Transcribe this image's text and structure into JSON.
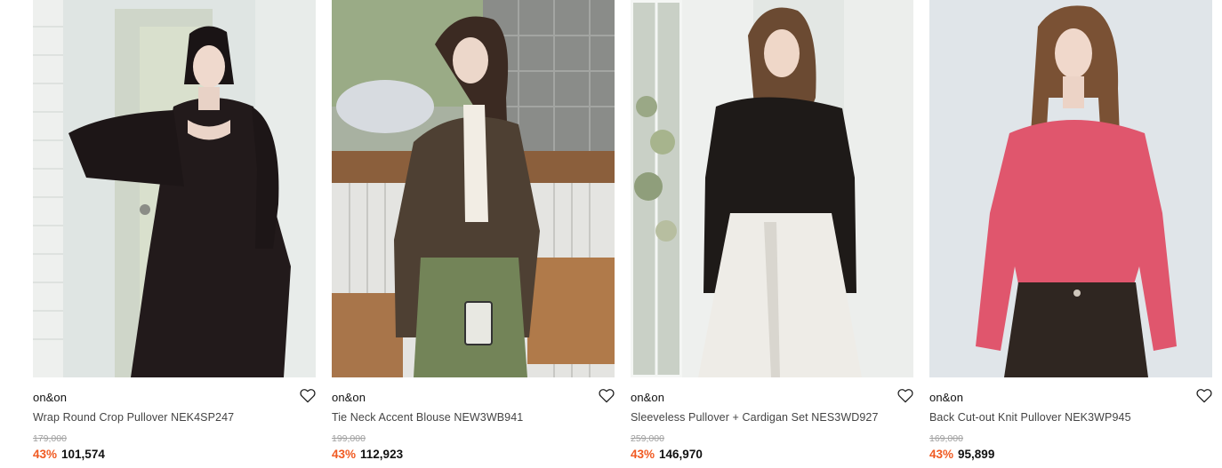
{
  "products": [
    {
      "brand": "on&on",
      "name": "Wrap Round Crop Pullover NEK4SP247",
      "original_price": "179,000",
      "discount": "43%",
      "sale_price": "101,574",
      "wishlist_icon": "heart-outline-icon",
      "colors": {
        "bg": "#dde3e1",
        "garment": "#211819"
      }
    },
    {
      "brand": "on&on",
      "name": "Tie Neck Accent Blouse NEW3WB941",
      "original_price": "199,000",
      "discount": "43%",
      "sale_price": "112,923",
      "wishlist_icon": "heart-outline-icon",
      "colors": {
        "bg": "#b9b6ab",
        "garment": "#4e4134"
      }
    },
    {
      "brand": "on&on",
      "name": "Sleeveless Pullover + Cardigan Set NES3WD927",
      "original_price": "259,000",
      "discount": "43%",
      "sale_price": "146,970",
      "wishlist_icon": "heart-outline-icon",
      "colors": {
        "bg": "#e7eae8",
        "garment": "#1c1a19"
      }
    },
    {
      "brand": "on&on",
      "name": "Back Cut-out Knit Pullover NEK3WP945",
      "original_price": "169,000",
      "discount": "43%",
      "sale_price": "95,899",
      "wishlist_icon": "heart-outline-icon",
      "colors": {
        "bg": "#dfe4e8",
        "garment": "#e0566d"
      }
    }
  ],
  "accent_color": "#f05a22"
}
